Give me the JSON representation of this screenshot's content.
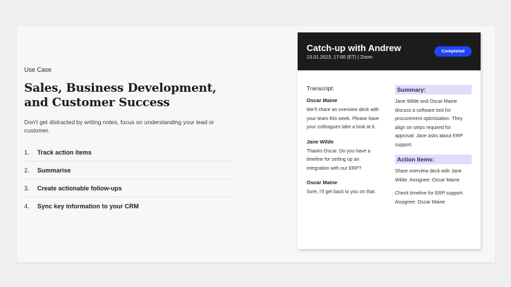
{
  "left": {
    "eyebrow": "Use Case",
    "title": "Sales, Business Development, and Customer Success",
    "description": "Don’t get distracted by writing notes, focus on understanding your lead or customer.",
    "features": [
      {
        "num": "1.",
        "label": "Track action items"
      },
      {
        "num": "2.",
        "label": "Summarise"
      },
      {
        "num": "3.",
        "label": "Create actionable follow-ups"
      },
      {
        "num": "4.",
        "label": "Sync key information to your CRM"
      }
    ]
  },
  "meeting": {
    "title": "Catch-up with Andrew",
    "subtitle": "13.01.2023, 17:00 (ET) | Zoom",
    "status": "Completed",
    "status_color": "#1f45f2",
    "transcript_heading": "Transcript:",
    "transcript": [
      {
        "speaker": "Oscar Maine",
        "text": "We’ll share an overview deck with your team this week. Please have your colleagues take a look at it."
      },
      {
        "speaker": "Jane Wilde",
        "text": "Thanks Oscar. Do you have a timeline for setting up an integration with our ERP?"
      },
      {
        "speaker": "Oscar Maine",
        "text": "Sure, I’ll get back to you on that."
      }
    ],
    "summary_heading": "Summary:",
    "summary_text": "Jane Wilde and Oscar Maine discuss a software tool for procurement optimisation. They align on steps required for approval. Jane asks about ERP support.",
    "action_heading": "Action Items:",
    "action_items": [
      "Share overview deck with Jane Wilde. Assignee: Oscar Maine",
      "Check timeline for ERP support. Assignee: Oscar Maine"
    ],
    "highlight_color": "#e2dcfb"
  }
}
